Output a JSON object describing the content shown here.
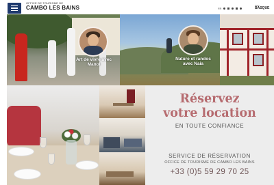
{
  "header": {
    "logo_sup": "OFFICE DE TOURISME DE",
    "logo_main": "CAMBO LES BAINS",
    "brand_top": "Pays",
    "brand_bottom": "BASQUE",
    "lang_label": "FR"
  },
  "hero": {
    "left_caption": "Art de vivre avec Manol",
    "right_caption_line1": "Nature et randos",
    "right_caption_line2": "avec Naia"
  },
  "cta": {
    "title_line1": "Réservez",
    "title_line2": "votre location",
    "subtitle": "EN TOUTE CONFIANCE",
    "service": "SERVICE DE RÉSERVATION",
    "organisation": "OFFICE DE TOURISME DE CAMBO LES BAINS",
    "phone": "+33 (0)5 59 29 70 25"
  },
  "colors": {
    "menu_button": "#1f3a6e",
    "cta_title": "#b66b6f",
    "cta_background": "#ededed"
  }
}
